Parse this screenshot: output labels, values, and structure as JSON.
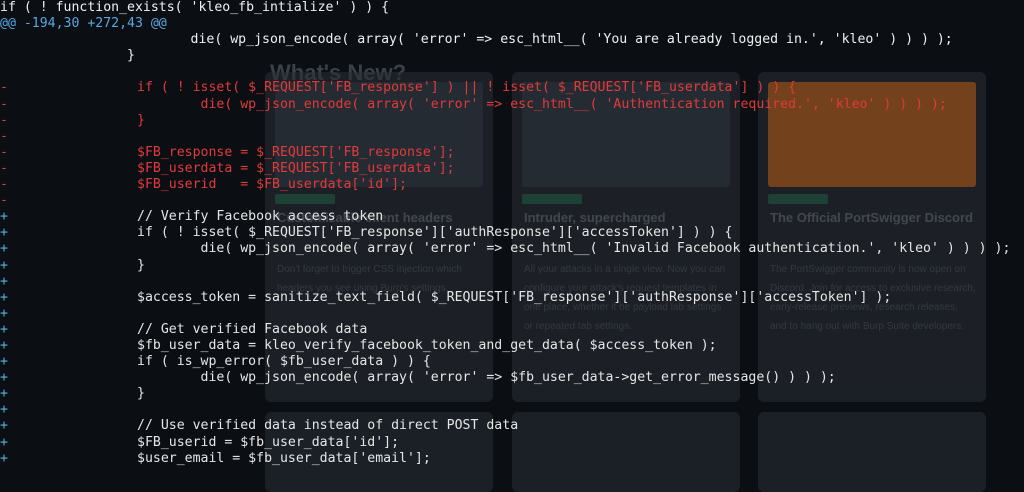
{
  "background": {
    "heading": "What's New?",
    "cards": [
      {
        "title": "Customizable client headers",
        "text": "Don't forget to trigger CSS injection which headers you see using Burp's settings."
      },
      {
        "title": "Intruder, supercharged",
        "text": "All your attacks in a single view. Now you can configure your attack's request templates in one place, whether it be payload lab settings or repeated tab settings."
      },
      {
        "title": "The Official PortSwigger Discord",
        "text": "The PortSwigger community is now open on Discord. Join for access to exclusive research, early-release previews, research releases, and to hang out with Burp Suite developers."
      }
    ]
  },
  "colors": {
    "deleted": "#e23a3a",
    "hunk": "#5aa7e0",
    "added_marker": "#4fb8d8"
  },
  "diff": [
    {
      "kind": "ctx",
      "mark": "",
      "text": "if ( ! function_exists( 'kleo_fb_intialize' ) ) {"
    },
    {
      "kind": "hunk",
      "mark": "",
      "text": "@@ -194,30 +272,43 @@"
    },
    {
      "kind": "ctx",
      "mark": "",
      "text": "                        die( wp_json_encode( array( 'error' => esc_html__( 'You are already logged in.', 'kleo' ) ) ) );"
    },
    {
      "kind": "ctx",
      "mark": "",
      "text": "                }"
    },
    {
      "kind": "ctx",
      "mark": "",
      "text": ""
    },
    {
      "kind": "del",
      "mark": "-",
      "text": "                if ( ! isset( $_REQUEST['FB_response'] ) || ! isset( $_REQUEST['FB_userdata'] ) ) {"
    },
    {
      "kind": "del",
      "mark": "-",
      "text": "                        die( wp_json_encode( array( 'error' => esc_html__( 'Authentication required.', 'kleo' ) ) ) );"
    },
    {
      "kind": "del",
      "mark": "-",
      "text": "                }"
    },
    {
      "kind": "del",
      "mark": "-",
      "text": ""
    },
    {
      "kind": "del",
      "mark": "-",
      "text": "                $FB_response = $_REQUEST['FB_response'];"
    },
    {
      "kind": "del",
      "mark": "-",
      "text": "                $FB_userdata = $_REQUEST['FB_userdata'];"
    },
    {
      "kind": "del",
      "mark": "-",
      "text": "                $FB_userid   = $FB_userdata['id'];"
    },
    {
      "kind": "del",
      "mark": "-",
      "text": ""
    },
    {
      "kind": "add",
      "mark": "+",
      "text": "                // Verify Facebook access token"
    },
    {
      "kind": "add",
      "mark": "+",
      "text": "                if ( ! isset( $_REQUEST['FB_response']['authResponse']['accessToken'] ) ) {"
    },
    {
      "kind": "add",
      "mark": "+",
      "text": "                        die( wp_json_encode( array( 'error' => esc_html__( 'Invalid Facebook authentication.', 'kleo' ) ) ) );"
    },
    {
      "kind": "add",
      "mark": "+",
      "text": "                }"
    },
    {
      "kind": "add",
      "mark": "+",
      "text": ""
    },
    {
      "kind": "add",
      "mark": "+",
      "text": "                $access_token = sanitize_text_field( $_REQUEST['FB_response']['authResponse']['accessToken'] );"
    },
    {
      "kind": "add",
      "mark": "+",
      "text": ""
    },
    {
      "kind": "add",
      "mark": "+",
      "text": "                // Get verified Facebook data"
    },
    {
      "kind": "add",
      "mark": "+",
      "text": "                $fb_user_data = kleo_verify_facebook_token_and_get_data( $access_token );"
    },
    {
      "kind": "add",
      "mark": "+",
      "text": "                if ( is_wp_error( $fb_user_data ) ) {"
    },
    {
      "kind": "add",
      "mark": "+",
      "text": "                        die( wp_json_encode( array( 'error' => $fb_user_data->get_error_message() ) ) );"
    },
    {
      "kind": "add",
      "mark": "+",
      "text": "                }"
    },
    {
      "kind": "add",
      "mark": "+",
      "text": ""
    },
    {
      "kind": "add",
      "mark": "+",
      "text": "                // Use verified data instead of direct POST data"
    },
    {
      "kind": "add",
      "mark": "+",
      "text": "                $FB_userid = $fb_user_data['id'];"
    },
    {
      "kind": "add",
      "mark": "+",
      "text": "                $user_email = $fb_user_data['email'];"
    }
  ]
}
